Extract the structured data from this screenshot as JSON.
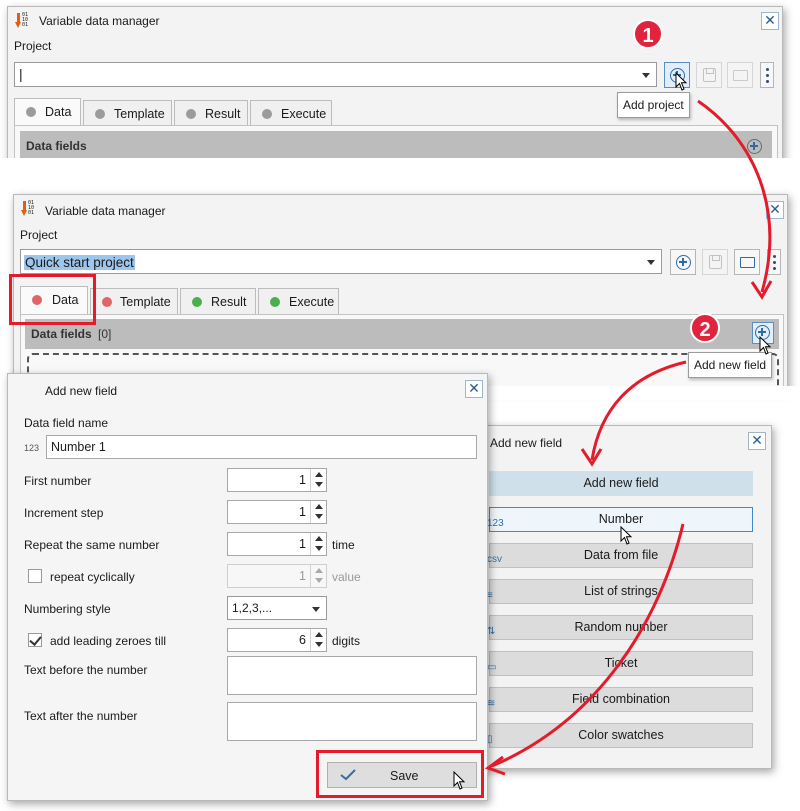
{
  "window1": {
    "title": "Variable data manager",
    "close": "✕",
    "project_label": "Project",
    "project_value": "|",
    "tooltip": "Add project",
    "badge": "1",
    "tabs": [
      "Data",
      "Template",
      "Result",
      "Execute"
    ],
    "section_title": "Data fields"
  },
  "window2": {
    "title": "Variable data manager",
    "close": "✕",
    "project_label": "Project",
    "project_value": "Quick start project",
    "tabs": [
      "Data",
      "Template",
      "Result",
      "Execute"
    ],
    "section_title": "Data fields",
    "section_count": "[0]",
    "tooltip": "Add new field",
    "badge": "2"
  },
  "dialog_field": {
    "title": "Add new field",
    "close": "✕",
    "name_label": "Data field name",
    "name_icon": "123",
    "name_value": "Number 1",
    "first_number_label": "First number",
    "first_number_value": "1",
    "increment_label": "Increment step",
    "increment_value": "1",
    "repeat_label": "Repeat the same number",
    "repeat_value": "1",
    "repeat_unit": "time",
    "cyclic_label": "repeat cyclically",
    "cyclic_value": "1",
    "cyclic_unit": "value",
    "style_label": "Numbering style",
    "style_value": "1,2,3,...",
    "zeroes_label": "add leading zeroes till",
    "zeroes_value": "6",
    "zeroes_unit": "digits",
    "text_before_label": "Text before the number",
    "text_after_label": "Text after the number",
    "save_label": "Save"
  },
  "dialog_types": {
    "title": "Add new field",
    "close": "✕",
    "header": "Add new field",
    "items": [
      "Number",
      "Data from file",
      "List of strings",
      "Random number",
      "Ticket",
      "Field combination",
      "Color swatches"
    ],
    "item_icons": [
      "123",
      "csv",
      "≡",
      "⇅",
      "▭",
      "≋",
      "▯"
    ]
  },
  "colors": {
    "callout_red": "#e41b2b",
    "badge_red": "#e2233d",
    "accent_blue": "#2e6ca6",
    "tab_dot_red": "#e06565",
    "tab_dot_green": "#4cae4c"
  }
}
